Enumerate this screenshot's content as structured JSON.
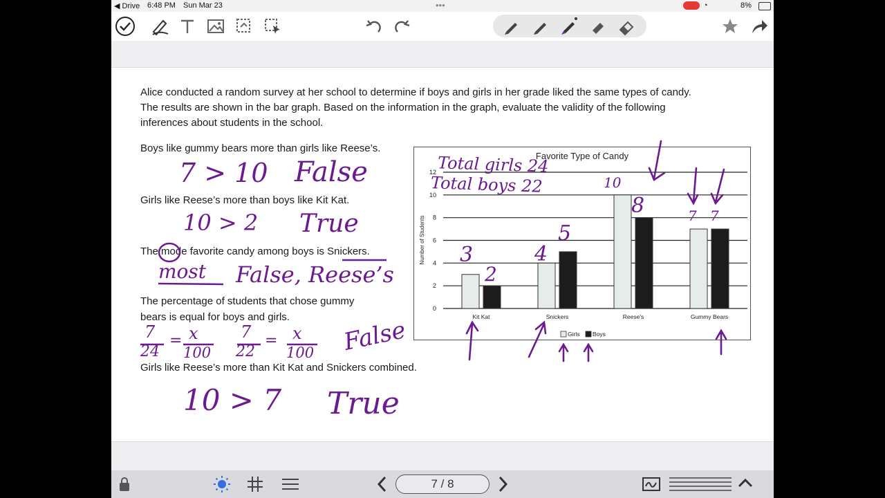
{
  "status": {
    "back_app": "◀ Drive",
    "time": "6:48 PM",
    "date": "Sun Mar 23",
    "battery": "8%",
    "dots": "•••"
  },
  "toolbar": {
    "tools": [
      "check-icon",
      "pen-scribble-icon",
      "text-icon",
      "image-icon",
      "lasso-icon",
      "selection-icon"
    ],
    "undo": "undo-icon",
    "redo": "redo-icon",
    "pens": [
      "pen-icon",
      "pen-icon",
      "pen-active-icon",
      "highlighter-icon",
      "eraser-icon"
    ],
    "favorite": "star-icon",
    "share": "share-icon"
  },
  "document": {
    "intro": [
      "Alice conducted a random survey at her school to determine if boys and girls in her grade liked the same types of candy.",
      "The results are shown in the bar graph. Based on the information in the graph, evaluate the validity of the following",
      "inferences about students in the school."
    ],
    "q1": "Boys like gummy bears more than girls like Reese’s.",
    "q2": "Girls like Reese’s more than boys like Kit Kat.",
    "q3": "The mode favorite candy among boys is Snickers.",
    "q4_line1": "The percentage of students that chose gummy",
    "q4_line2": "bears is equal for boys and girls.",
    "q5": "Girls like Reese’s more than Kit Kat and Snickers combined."
  },
  "handwriting": {
    "a1_expr": "7 > 10",
    "a1_ans": "False",
    "a2_expr": "10 > 2",
    "a2_ans": "True",
    "a3_word": "most",
    "a3_ans": "False, Reese’s",
    "a4_f1n": "7",
    "a4_f1d": "24",
    "a4_eq": "=",
    "a4_x": "x",
    "a4_100": "100",
    "a4_f2n": "7",
    "a4_f2d": "22",
    "a4_ans": "False",
    "a5_expr": "10 > 7",
    "a5_ans": "True",
    "total_girls": "Total girls 24",
    "total_boys": "Total boys 22",
    "bar_labels": [
      "3",
      "2",
      "4",
      "5",
      "10",
      "8",
      "7",
      "7"
    ]
  },
  "chart_data": {
    "type": "bar",
    "title": "Favorite Type of Candy",
    "ylabel": "Number of Students",
    "xlabel": "",
    "categories": [
      "Kit Kat",
      "Snickers",
      "Reese's",
      "Gummy Bears"
    ],
    "series": [
      {
        "name": "Girls",
        "values": [
          3,
          4,
          10,
          7
        ],
        "color": "#e6ecea"
      },
      {
        "name": "Boys",
        "values": [
          2,
          5,
          8,
          7
        ],
        "color": "#1c1c1c"
      }
    ],
    "ylim": [
      0,
      12
    ],
    "yticks": [
      "0",
      "2",
      "4",
      "6",
      "8",
      "10",
      "12"
    ],
    "grid": true,
    "legend": "bottom"
  },
  "bottom": {
    "page_indicator": "7 / 8",
    "lock": "lock-icon",
    "brightness": "brightness-icon",
    "grid": "grid-icon",
    "list": "list-icon",
    "prev": "chevron-left-icon",
    "next": "chevron-right-icon",
    "signature": "signature-icon",
    "lines": "lines-icon",
    "expand": "chevron-up-icon"
  }
}
